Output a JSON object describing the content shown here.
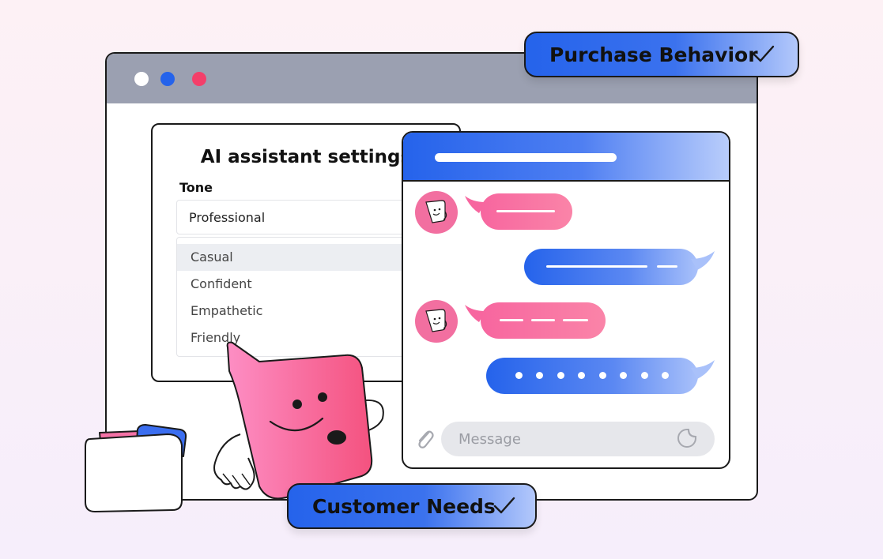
{
  "settings": {
    "title": "AI assistant settings",
    "tone_label": "Tone",
    "selected": "Professional",
    "options": [
      "Casual",
      "Confident",
      "Empathetic",
      "Friendly"
    ],
    "highlighted_option": "Casual"
  },
  "chat": {
    "input_placeholder": "Message",
    "icons": [
      "paperclip-icon",
      "sticker-icon"
    ]
  },
  "badges": {
    "purchase": "Purchase Behavior",
    "customer": "Customer Needs",
    "icon": "check-icon"
  },
  "colors": {
    "accent_blue": "#2563eb",
    "accent_pink": "#f7669f",
    "titlebar_gray": "#9ba0b1",
    "dot_red": "#f43f6a"
  }
}
